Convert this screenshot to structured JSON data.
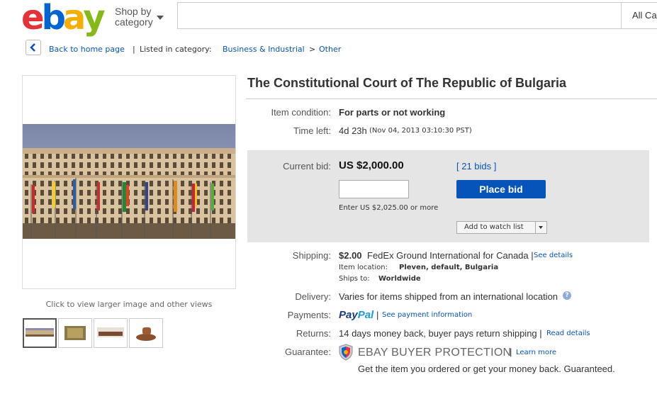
{
  "header": {
    "logo": {
      "e": "e",
      "b": "b",
      "a": "a",
      "y": "y"
    },
    "logo_colors": {
      "e": "#e53238",
      "b": "#0064d2",
      "a": "#f5af02",
      "y": "#86b817"
    },
    "shop_by": "Shop by",
    "category": "category",
    "search_placeholder": "",
    "all_categories": "All Categories"
  },
  "breadcrumb": {
    "back": "Back to home page",
    "sep": "|",
    "listed": "Listed in category:",
    "cat1": "Business & Industrial",
    "gt": ">",
    "cat2": "Other"
  },
  "gallery": {
    "caption": "Click to view larger image and other views"
  },
  "item": {
    "title": "The Constitutional Court of The Republic of Bulgaria",
    "condition_label": "Item condition:",
    "condition": "For parts or not working",
    "time_label": "Time left:",
    "time_left": "4d 23h",
    "end_time": "(Nov 04, 2013  03:10:30 PST)"
  },
  "bid": {
    "current_label": "Current bid:",
    "current": "US $2,000.00",
    "bids": "[ 21 bids ]",
    "input_value": "",
    "place_bid": "Place bid",
    "enter_hint": "Enter US $2,025.00 or more",
    "watch": "Add to watch list"
  },
  "shipping": {
    "label": "Shipping:",
    "cost": "$2.00",
    "method": "FedEx Ground International for Canada |",
    "details": "See details",
    "location_label": "Item location:",
    "location": "Pleven, default, Bulgaria",
    "ships_label": "Ships to:",
    "ships": "Worldwide"
  },
  "delivery": {
    "label": "Delivery:",
    "text": "Varies for items shipped from an international location",
    "help": "?"
  },
  "payments": {
    "label": "Payments:",
    "pay": "Pay",
    "pal": "Pal",
    "sep": "|",
    "info": "See payment information"
  },
  "returns": {
    "label": "Returns:",
    "text": "14 days money back, buyer pays return shipping |",
    "link": "Read details"
  },
  "guarantee": {
    "label": "Guarantee:",
    "brand": "EBAY BUYER PROTECTION",
    "sep": "|",
    "link": "Learn more",
    "text": "Get the item you ordered or get your money back. Guaranteed."
  }
}
